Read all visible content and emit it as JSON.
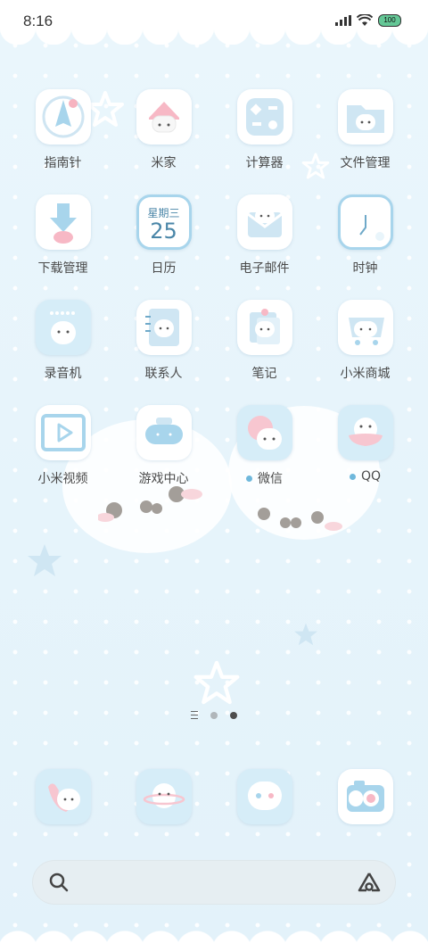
{
  "status": {
    "time": "8:16",
    "battery": "100"
  },
  "apps": [
    {
      "label": "指南针",
      "icon": "compass-icon",
      "dot": false
    },
    {
      "label": "米家",
      "icon": "home-icon",
      "dot": false
    },
    {
      "label": "计算器",
      "icon": "calculator-icon",
      "dot": false
    },
    {
      "label": "文件管理",
      "icon": "folder-icon",
      "dot": false
    },
    {
      "label": "下载管理",
      "icon": "download-icon",
      "dot": false
    },
    {
      "label": "日历",
      "icon": "calendar-icon",
      "dot": false,
      "weekday": "星期三",
      "day": "25"
    },
    {
      "label": "电子邮件",
      "icon": "mail-icon",
      "dot": false
    },
    {
      "label": "时钟",
      "icon": "clock-icon",
      "dot": false
    },
    {
      "label": "录音机",
      "icon": "recorder-icon",
      "dot": false
    },
    {
      "label": "联系人",
      "icon": "contacts-icon",
      "dot": false
    },
    {
      "label": "笔记",
      "icon": "notes-icon",
      "dot": false
    },
    {
      "label": "小米商城",
      "icon": "shop-cart-icon",
      "dot": false
    },
    {
      "label": "小米视频",
      "icon": "video-play-icon",
      "dot": false
    },
    {
      "label": "游戏中心",
      "icon": "gamepad-icon",
      "dot": false
    },
    {
      "label": "微信",
      "icon": "wechat-icon",
      "dot": true
    },
    {
      "label": "QQ",
      "icon": "qq-icon",
      "dot": true
    }
  ],
  "dock": [
    {
      "icon": "phone-icon"
    },
    {
      "icon": "browser-icon"
    },
    {
      "icon": "messages-icon"
    },
    {
      "icon": "camera-icon"
    }
  ],
  "colors": {
    "accent": "#6fb8dc",
    "background": "#e6f4fb"
  }
}
